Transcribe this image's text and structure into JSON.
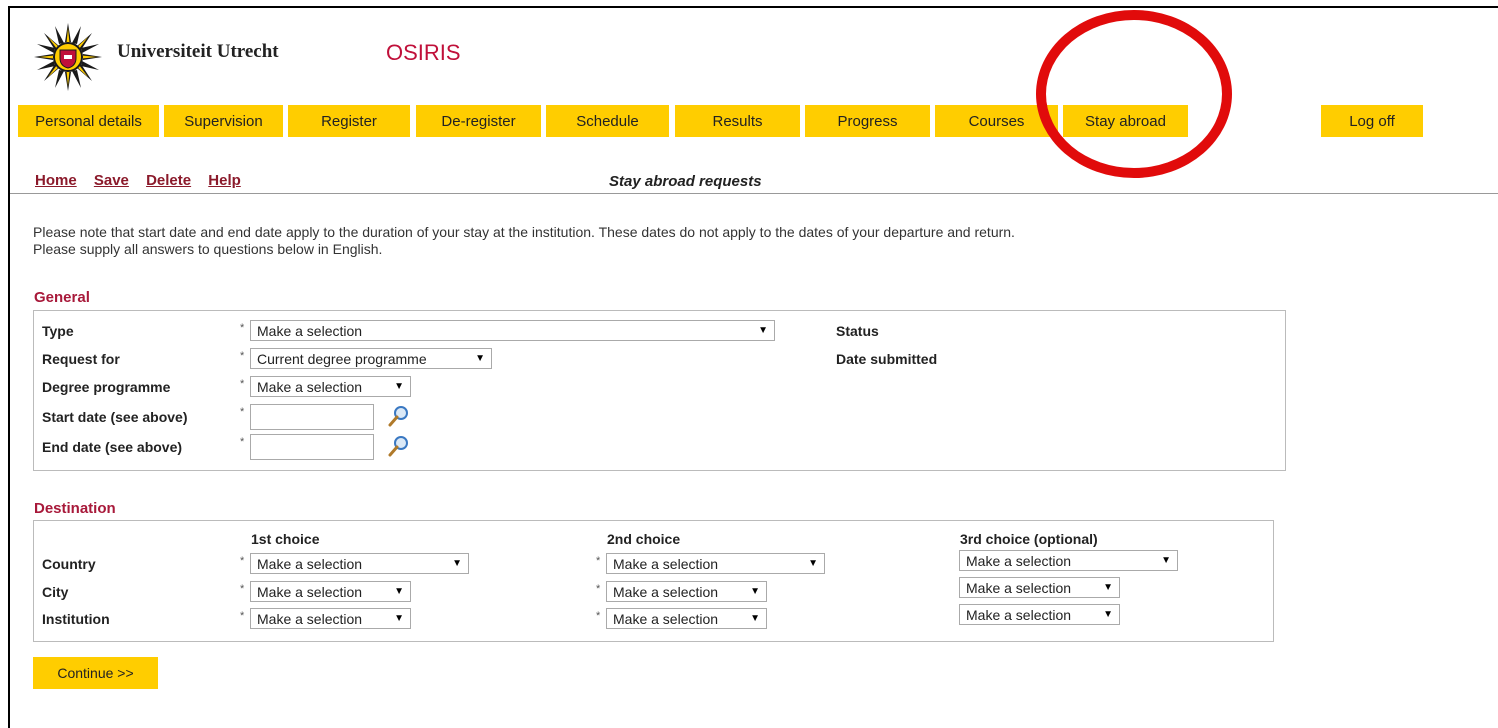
{
  "header": {
    "university": "Universiteit Utrecht",
    "app": "OSIRIS"
  },
  "nav": [
    {
      "label": "Personal details"
    },
    {
      "label": "Supervision"
    },
    {
      "label": "Register"
    },
    {
      "label": "De-register"
    },
    {
      "label": "Schedule"
    },
    {
      "label": "Results"
    },
    {
      "label": "Progress"
    },
    {
      "label": "Courses"
    },
    {
      "label": "Stay abroad"
    },
    {
      "label": "Log off"
    }
  ],
  "toolbar": {
    "home": "Home",
    "save": "Save",
    "delete": "Delete",
    "help": "Help",
    "title": "Stay abroad requests"
  },
  "notice": {
    "line1": "Please note that start date and end date apply to the duration of your stay at the institution. These dates do not apply to the dates of your departure and return.",
    "line2": "Please supply all answers to questions below in English."
  },
  "general": {
    "title": "General",
    "required_mark": "*",
    "type_label": "Type",
    "type_value": "Make a selection",
    "request_label": "Request for",
    "request_value": "Current degree programme",
    "degree_label": "Degree programme",
    "degree_value": "Make a selection",
    "start_label": "Start date (see above)",
    "start_value": "",
    "end_label": "End date (see above)",
    "end_value": "",
    "status_label": "Status",
    "submitted_label": "Date submitted"
  },
  "destination": {
    "title": "Destination",
    "rows": {
      "country": "Country",
      "city": "City",
      "institution": "Institution"
    },
    "choices": [
      {
        "heading": "1st choice",
        "country": "Make a selection",
        "city": "Make a selection",
        "institution": "Make a selection"
      },
      {
        "heading": "2nd choice",
        "country": "Make a selection",
        "city": "Make a selection",
        "institution": "Make a selection"
      },
      {
        "heading": "3rd choice (optional)",
        "country": "Make a selection",
        "city": "Make a selection",
        "institution": "Make a selection"
      }
    ]
  },
  "continue_label": "Continue >>",
  "colors": {
    "accent": "#ffcd00",
    "brand": "#c0103a",
    "link": "#8b1a2b",
    "annotation": "#e10b0b"
  },
  "icons": {
    "logo": "university-sun-logo",
    "lookup": "magnifier-icon",
    "dropdown": "triangle-down-icon"
  }
}
